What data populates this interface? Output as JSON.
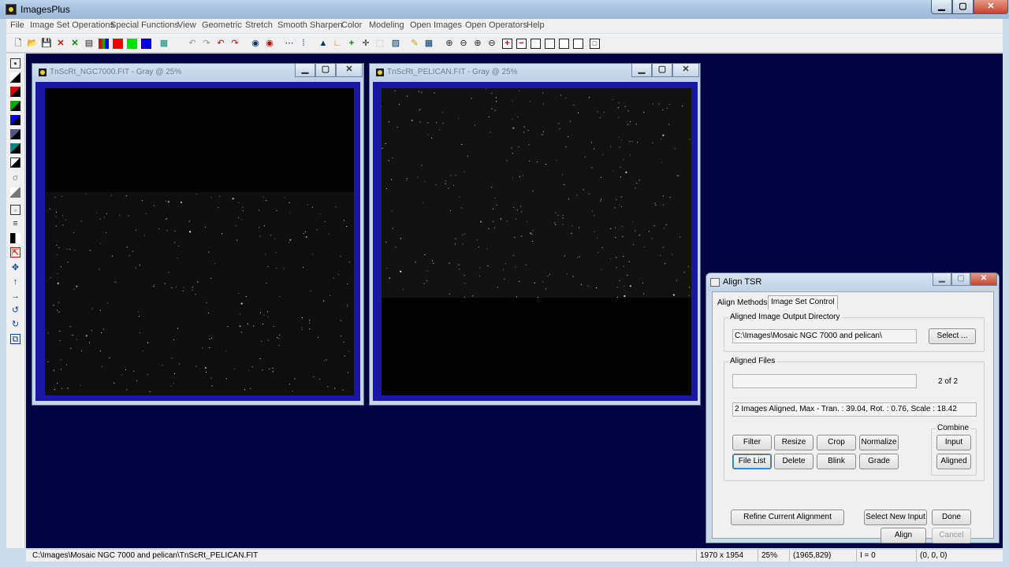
{
  "app": {
    "title": "ImagesPlus"
  },
  "menu": [
    "File",
    "Image Set Operations",
    "Special Functions",
    "View",
    "Geometric",
    "Stretch",
    "Smooth Sharpen",
    "Color",
    "Modeling",
    "Open Images",
    "Open Operators",
    "Help"
  ],
  "windows": [
    {
      "title": "TnScRt_NGC7000.FIT - Gray @ 25%"
    },
    {
      "title": "TnScRt_PELICAN.FIT - Gray @ 25%"
    }
  ],
  "dialog": {
    "title": "Align TSR",
    "tabs": [
      "Align Methods",
      "Image Set Control"
    ],
    "active_tab": "Image Set Control",
    "output_dir": {
      "label": "Aligned Image Output Directory",
      "value": "C:\\Images\\Mosaic NGC 7000 and pelican\\",
      "select_button": "Select ..."
    },
    "aligned_files": {
      "label": "Aligned Files",
      "current_file": "",
      "counter": "2  of  2",
      "summary": "2 Images Aligned, Max - Tran. : 39.04, Rot. :  0.76, Scale : 18.42"
    },
    "file_buttons": [
      "Filter",
      "Resize",
      "Crop",
      "Normalize",
      "File List",
      "Delete",
      "Blink",
      "Grade"
    ],
    "combine": {
      "label": "Combine",
      "buttons": [
        "Input",
        "Aligned"
      ]
    },
    "bottom_buttons": {
      "refine": "Refine Current Alignment",
      "select_new_input": "Select New Input",
      "done": "Done",
      "align": "Align",
      "cancel": "Cancel"
    }
  },
  "status": {
    "path": "C:\\Images\\Mosaic NGC 7000 and pelican\\TnScRt_PELICAN.FIT",
    "dimensions": "1970 x 1954",
    "zoom": "25%",
    "coords": "(1965,829)",
    "intensity": "I = 0",
    "rgb": "(0, 0, 0)"
  },
  "colors": {
    "mdi_background": "#030343",
    "image_frame": "#1b16a3"
  }
}
